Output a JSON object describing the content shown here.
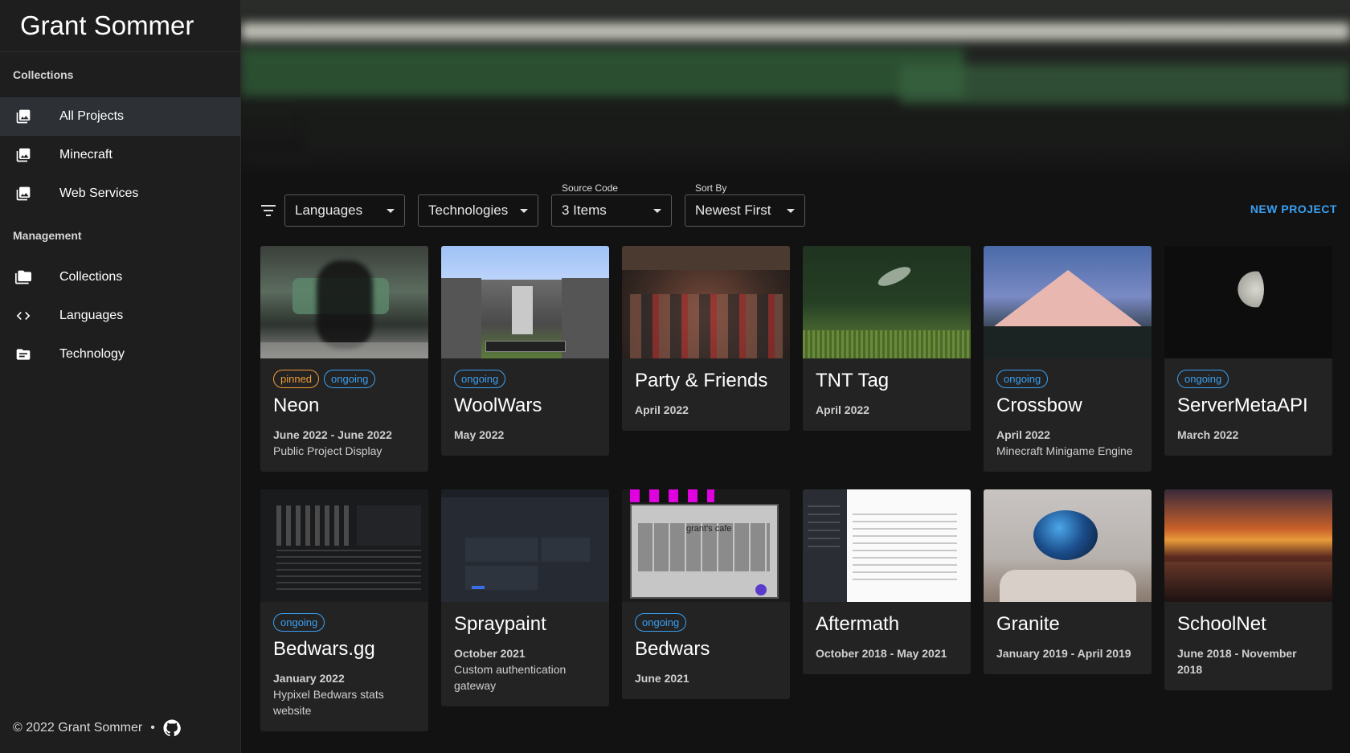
{
  "brand": "Grant Sommer",
  "sidebar": {
    "collections_title": "Collections",
    "collections": [
      {
        "label": "All Projects",
        "icon": "photo-library-icon",
        "active": true
      },
      {
        "label": "Minecraft",
        "icon": "photo-library-icon"
      },
      {
        "label": "Web Services",
        "icon": "photo-library-icon"
      }
    ],
    "management_title": "Management",
    "management": [
      {
        "label": "Collections",
        "icon": "folders-icon"
      },
      {
        "label": "Languages",
        "icon": "code-icon"
      },
      {
        "label": "Technology",
        "icon": "folder-icon"
      }
    ],
    "footer": {
      "copyright": "© 2022 Grant Sommer",
      "separator": "•",
      "github_icon": "github-icon"
    }
  },
  "toolbar": {
    "filter_icon": "filter-icon",
    "languages": {
      "value": "Languages"
    },
    "technologies": {
      "value": "Technologies"
    },
    "source_code": {
      "label": "Source Code",
      "value": "3 Items"
    },
    "sort_by": {
      "label": "Sort By",
      "value": "Newest First"
    },
    "new_project": "NEW PROJECT"
  },
  "projects": [
    {
      "title": "Neon",
      "date": "June 2022 - June 2022",
      "desc": "Public Project Display",
      "chips": [
        "pinned",
        "ongoing"
      ]
    },
    {
      "title": "WoolWars",
      "date": "May 2022",
      "desc": "",
      "chips": [
        "ongoing"
      ]
    },
    {
      "title": "Party & Friends",
      "date": "April 2022",
      "desc": "",
      "chips": []
    },
    {
      "title": "TNT Tag",
      "date": "April 2022",
      "desc": "",
      "chips": []
    },
    {
      "title": "Crossbow",
      "date": "April 2022",
      "desc": "Minecraft Minigame Engine",
      "chips": [
        "ongoing"
      ]
    },
    {
      "title": "ServerMetaAPI",
      "date": "March 2022",
      "desc": "",
      "chips": [
        "ongoing"
      ]
    },
    {
      "title": "Bedwars.gg",
      "date": "January 2022",
      "desc": "Hypixel Bedwars stats website",
      "chips": [
        "ongoing"
      ]
    },
    {
      "title": "Spraypaint",
      "date": "October 2021",
      "desc": "Custom authentication gateway",
      "chips": []
    },
    {
      "title": "Bedwars",
      "date": "June 2021",
      "desc": "",
      "chips": [
        "ongoing"
      ],
      "thumb_text": "grant's cafe"
    },
    {
      "title": "Aftermath",
      "date": "October 2018 - May 2021",
      "desc": "",
      "chips": []
    },
    {
      "title": "Granite",
      "date": "January 2019 - April 2019",
      "desc": "",
      "chips": []
    },
    {
      "title": "SchoolNet",
      "date": "June 2018 - November 2018",
      "desc": "",
      "chips": []
    }
  ],
  "colors": {
    "accent": "#3aa0f2",
    "pinned": "#f39c35",
    "sidebar_bg": "#1e1e1e",
    "card_bg": "#232323"
  }
}
